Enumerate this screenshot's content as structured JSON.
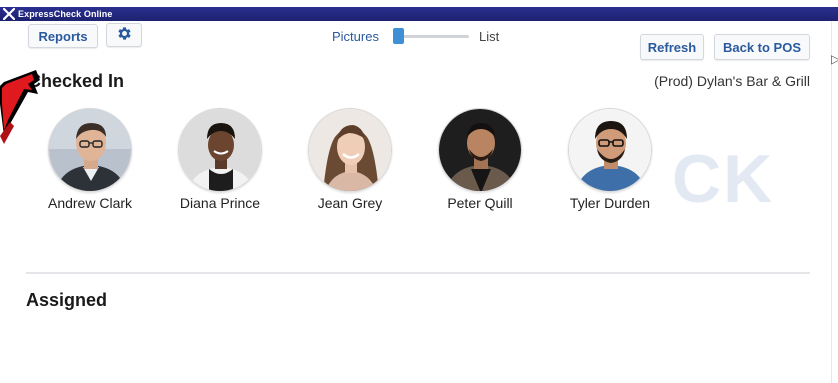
{
  "window": {
    "title": "ExpressCheck Online",
    "icon": "app-x-icon"
  },
  "toolbar": {
    "reports_label": "Reports",
    "settings_icon": "gear-icon",
    "view_toggle": {
      "pictures_label": "Pictures",
      "list_label": "List",
      "position": 0
    },
    "refresh_label": "Refresh",
    "back_to_pos_label": "Back to POS"
  },
  "checked_in": {
    "title": "Checked In",
    "venue": "(Prod) Dylan's Bar & Grill",
    "people": [
      {
        "name": "Andrew Clark"
      },
      {
        "name": "Diana Prince"
      },
      {
        "name": "Jean Grey"
      },
      {
        "name": "Peter Quill"
      },
      {
        "name": "Tyler Durden"
      }
    ]
  },
  "watermark": "CK",
  "assigned": {
    "title": "Assigned"
  },
  "colors": {
    "titlebar": "#1d2270",
    "accent": "#2a5a9e",
    "slider_thumb": "#3f8fd6",
    "annotation_arrow": "#e0191e"
  }
}
